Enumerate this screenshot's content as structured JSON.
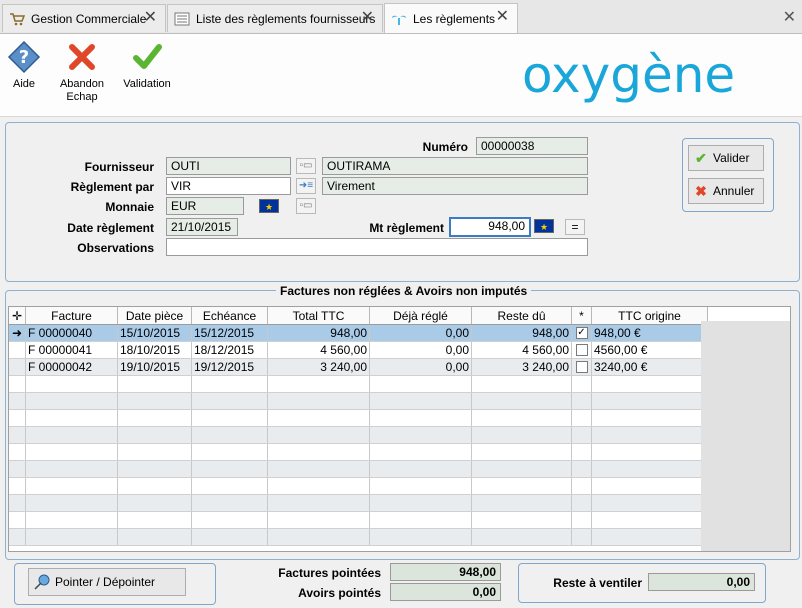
{
  "tabs": [
    {
      "label": "Gestion Commerciale",
      "active": false
    },
    {
      "label": "Liste des règlements fournisseurs",
      "active": false
    },
    {
      "label": "Les règlements",
      "active": true
    }
  ],
  "toolbar": {
    "aide": "Aide",
    "abandon": "Abandon",
    "abandon_sub": "Echap",
    "validation": "Validation",
    "logo": "oxygène"
  },
  "form": {
    "numero_label": "Numéro",
    "numero": "00000038",
    "fournisseur_label": "Fournisseur",
    "fournisseur_code": "OUTI",
    "fournisseur_name": "OUTIRAMA",
    "reglement_label": "Règlement par",
    "reglement_code": "VIR",
    "reglement_name": "Virement",
    "monnaie_label": "Monnaie",
    "monnaie": "EUR",
    "date_label": "Date règlement",
    "date": "21/10/2015",
    "mt_label": "Mt règlement",
    "mt": "948,00",
    "equals": "=",
    "obs_label": "Observations",
    "obs": ""
  },
  "actions": {
    "valider": "Valider",
    "annuler": "Annuler"
  },
  "group_title": "Factures non réglées & Avoirs non imputés",
  "grid": {
    "columns": [
      "Facture",
      "Date pièce",
      "Echéance",
      "Total TTC",
      "Déjà réglé",
      "Reste dû",
      "*",
      "TTC origine"
    ],
    "rows": [
      {
        "facture": "F 00000040",
        "date": "15/10/2015",
        "echeance": "15/12/2015",
        "total": "948,00",
        "regle": "0,00",
        "reste": "948,00",
        "checked": true,
        "origine": "948,00 €"
      },
      {
        "facture": "F 00000041",
        "date": "18/10/2015",
        "echeance": "18/12/2015",
        "total": "4 560,00",
        "regle": "0,00",
        "reste": "4 560,00",
        "checked": false,
        "origine": "4560,00 €"
      },
      {
        "facture": "F 00000042",
        "date": "19/10/2015",
        "echeance": "19/12/2015",
        "total": "3 240,00",
        "regle": "0,00",
        "reste": "3 240,00",
        "checked": false,
        "origine": "3240,00 €"
      }
    ],
    "empty_rows": 10
  },
  "footer": {
    "pointer": "Pointer / Dépointer",
    "factures_label": "Factures pointées",
    "factures_value": "948,00",
    "avoirs_label": "Avoirs pointés",
    "avoirs_value": "0,00",
    "reste_label": "Reste à ventiler",
    "reste_value": "0,00"
  },
  "colors": {
    "accent": "#1aa6d8",
    "selection": "#aacbe8",
    "panel_border": "#8fb0cf"
  }
}
